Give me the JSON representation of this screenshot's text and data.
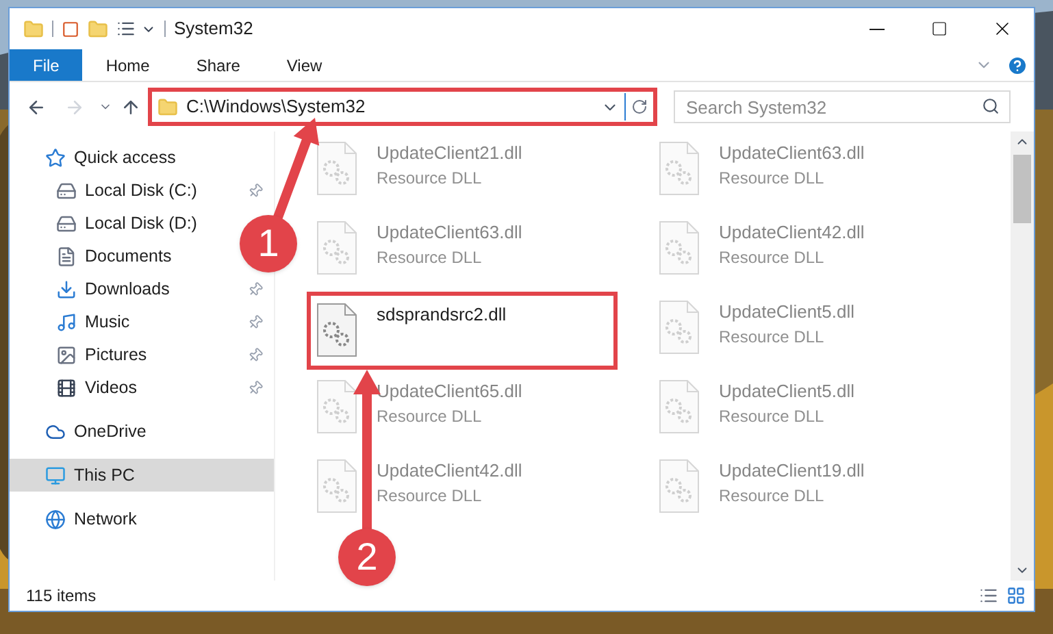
{
  "window": {
    "title": "System32"
  },
  "ribbon_tabs": [
    {
      "label": "File",
      "selected": true
    },
    {
      "label": "Home",
      "selected": false
    },
    {
      "label": "Share",
      "selected": false
    },
    {
      "label": "View",
      "selected": false
    }
  ],
  "address": {
    "path": "C:\\Windows\\System32"
  },
  "search": {
    "placeholder": "Search System32"
  },
  "sidebar": {
    "items": [
      {
        "label": "Quick access",
        "kind": "quick",
        "pinned": false,
        "selected": false,
        "children": [
          {
            "label": "Local Disk (C:)",
            "kind": "disk",
            "pinned": true,
            "selected": false
          },
          {
            "label": "Local Disk (D:)",
            "kind": "disk",
            "pinned": false,
            "selected": false
          },
          {
            "label": "Documents",
            "kind": "documents",
            "pinned": false,
            "selected": false
          },
          {
            "label": "Downloads",
            "kind": "downloads",
            "pinned": true,
            "selected": false
          },
          {
            "label": "Music",
            "kind": "music",
            "pinned": true,
            "selected": false
          },
          {
            "label": "Pictures",
            "kind": "pictures",
            "pinned": true,
            "selected": false
          },
          {
            "label": "Videos",
            "kind": "videos",
            "pinned": true,
            "selected": false
          }
        ]
      },
      {
        "label": "OneDrive",
        "kind": "cloud",
        "pinned": false,
        "selected": false
      },
      {
        "label": "This PC",
        "kind": "pc",
        "pinned": false,
        "selected": true
      },
      {
        "label": "Network",
        "kind": "network",
        "pinned": false,
        "selected": false
      }
    ]
  },
  "files": [
    {
      "name": "UpdateClient21.dll",
      "type": "Resource DLL",
      "blurred": true
    },
    {
      "name": "UpdateClient63.dll",
      "type": "Resource DLL",
      "blurred": true
    },
    {
      "name": "UpdateClient63.dll",
      "type": "Resource DLL",
      "blurred": true
    },
    {
      "name": "UpdateClient42.dll",
      "type": "Resource DLL",
      "blurred": true
    },
    {
      "name": "sdsprandsrc2.dll",
      "blurred": false,
      "highlighted": true
    },
    {
      "name": "UpdateClient5.dll",
      "type": "Resource DLL",
      "blurred": true
    },
    {
      "name": "UpdateClient65.dll",
      "type": "Resource DLL",
      "blurred": true
    },
    {
      "name": "UpdateClient5.dll",
      "type": "Resource DLL",
      "blurred": true
    },
    {
      "name": "UpdateClient42.dll",
      "type": "Resource DLL",
      "blurred": true
    },
    {
      "name": "UpdateClient19.dll",
      "type": "Resource DLL",
      "blurred": true
    }
  ],
  "status_bar": {
    "count": "115 items"
  },
  "annotations": [
    {
      "label": "1"
    },
    {
      "label": "2"
    }
  ]
}
